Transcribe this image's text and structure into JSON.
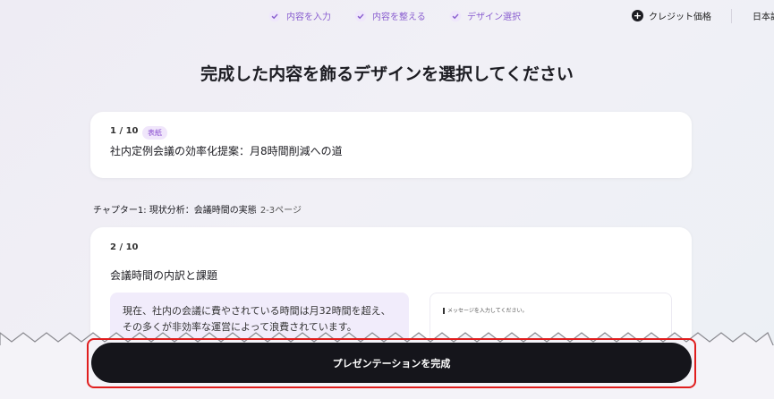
{
  "steps": [
    {
      "label": "内容を入力"
    },
    {
      "label": "内容を整える"
    },
    {
      "label": "デザイン選択"
    }
  ],
  "header": {
    "credit_label": "クレジット価格",
    "lang_label": "日本語"
  },
  "page_title": "完成した内容を飾るデザインを選択してください",
  "slides": [
    {
      "number": "1 / 10",
      "badge": "表紙",
      "title": "社内定例会議の効率化提案：月8時間削減への道"
    },
    {
      "number": "2 / 10",
      "title": "会議時間の内訳と課題",
      "content_line1": "現在、社内の会議に費やされている時間は月32時間を超え、",
      "content_line2": "その多くが非効率な運営によって浪費されています。",
      "message_placeholder": "メッセージを入力してください。"
    }
  ],
  "chapter": {
    "label": "チャプター1:  現状分析：会議時間の実態",
    "pages": "2-3ページ"
  },
  "cta": {
    "label": "プレゼンテーションを完成"
  },
  "colors": {
    "accent": "#8a5fd0",
    "button_bg": "#15151b",
    "highlight_frame": "#e01e1e"
  }
}
